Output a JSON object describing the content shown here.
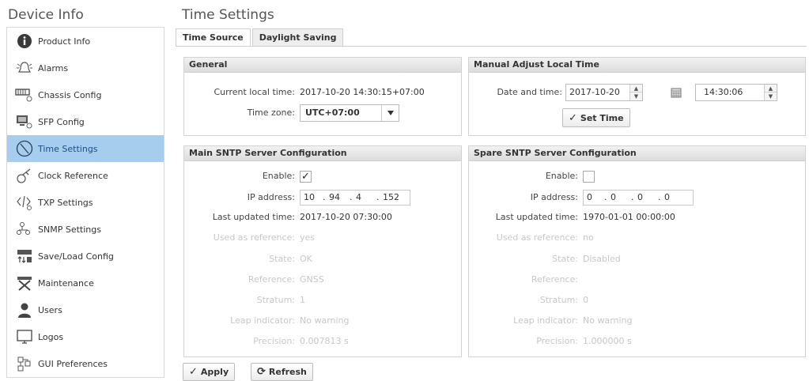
{
  "sidebar": {
    "title": "Device Info",
    "items": [
      {
        "label": "Product Info",
        "icon": "info-icon"
      },
      {
        "label": "Alarms",
        "icon": "bell-icon"
      },
      {
        "label": "Chassis Config",
        "icon": "chassis-icon"
      },
      {
        "label": "SFP Config",
        "icon": "sfp-icon"
      },
      {
        "label": "Time Settings",
        "icon": "clock-icon",
        "active": true
      },
      {
        "label": "Clock Reference",
        "icon": "satellite-icon"
      },
      {
        "label": "TXP Settings",
        "icon": "code-icon"
      },
      {
        "label": "SNMP Settings",
        "icon": "network-icon"
      },
      {
        "label": "Save/Load Config",
        "icon": "save-load-icon"
      },
      {
        "label": "Maintenance",
        "icon": "tools-icon"
      },
      {
        "label": "Users",
        "icon": "user-icon"
      },
      {
        "label": "Logos",
        "icon": "monitor-icon"
      },
      {
        "label": "GUI Preferences",
        "icon": "preferences-icon"
      }
    ]
  },
  "main": {
    "title": "Time Settings",
    "tabs": [
      "Time Source",
      "Daylight Saving"
    ]
  },
  "general": {
    "title": "General",
    "current_time_label": "Current local time:",
    "current_time_value": "2017-10-20 14:30:15+07:00",
    "timezone_label": "Time zone:",
    "timezone_value": "UTC+07:00"
  },
  "manual": {
    "title": "Manual Adjust Local Time",
    "date_time_label": "Date and time:",
    "date_value": "2017-10-20",
    "time_value": "14:30:06",
    "set_time_label": "Set Time"
  },
  "main_sntp": {
    "title": "Main SNTP Server Configuration",
    "enable_label": "Enable:",
    "enabled": true,
    "ip_label": "IP address:",
    "ip": [
      "10",
      "94",
      "4",
      "152"
    ],
    "last_updated_label": "Last updated time:",
    "last_updated_value": "2017-10-20 07:30:00",
    "used_as_reference_label": "Used as reference:",
    "used_as_reference_value": "yes",
    "state_label": "State:",
    "state_value": "OK",
    "reference_label": "Reference:",
    "reference_value": "GNSS",
    "stratum_label": "Stratum:",
    "stratum_value": "1",
    "leap_label": "Leap indicator:",
    "leap_value": "No warning",
    "precision_label": "Precision:",
    "precision_value": "0.007813 s"
  },
  "spare_sntp": {
    "title": "Spare SNTP Server Configuration",
    "enable_label": "Enable:",
    "enabled": false,
    "ip_label": "IP address:",
    "ip": [
      "0",
      "0",
      "0",
      "0"
    ],
    "last_updated_label": "Last updated time:",
    "last_updated_value": "1970-01-01 00:00:00",
    "used_as_reference_label": "Used as reference:",
    "used_as_reference_value": "no",
    "state_label": "State:",
    "state_value": "Disabled",
    "reference_label": "Reference:",
    "stratum_label": "Stratum:",
    "stratum_value": "0",
    "leap_label": "Leap indicator:",
    "leap_value": "No warning",
    "precision_label": "Precision:",
    "precision_value": "1.000000 s"
  },
  "footer": {
    "apply_label": "Apply",
    "refresh_label": "Refresh"
  }
}
